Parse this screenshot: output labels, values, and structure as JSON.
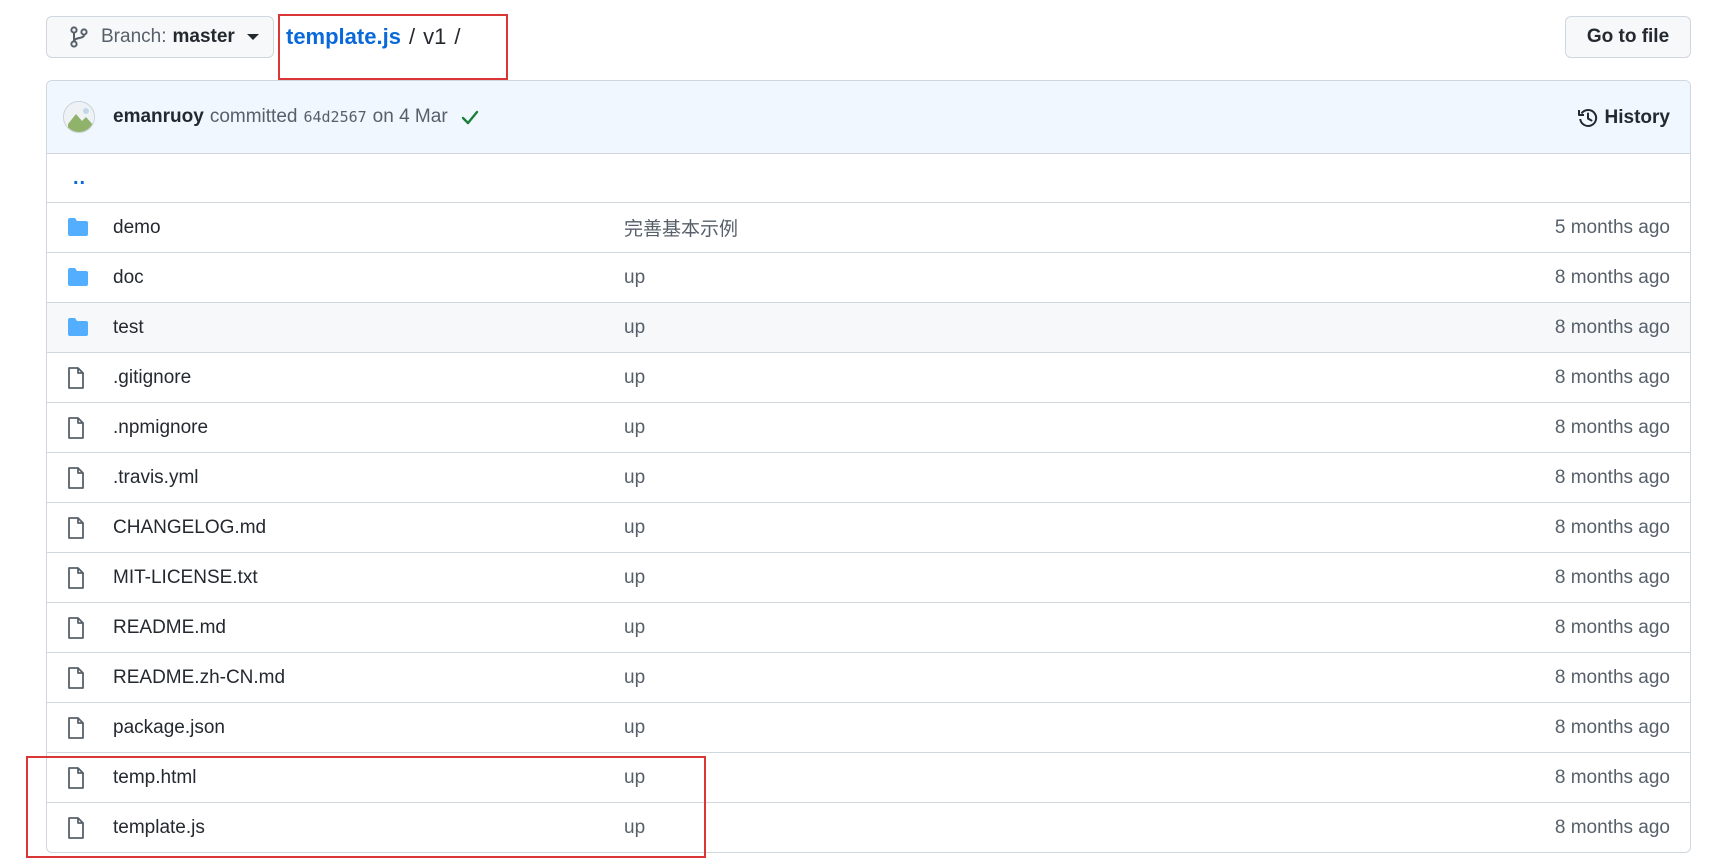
{
  "branch": {
    "label": "Branch:",
    "value": "master"
  },
  "breadcrumb": {
    "repo": "template.js",
    "sep1": "/",
    "segment": "v1",
    "sep2": "/"
  },
  "goto_file": "Go to file",
  "commit": {
    "author": "emanruoy",
    "verb": "committed",
    "sha": "64d2567",
    "date": "on 4 Mar",
    "history": "History"
  },
  "parent_link": "..",
  "files": [
    {
      "name": "demo",
      "type": "folder",
      "message": "完善基本示例",
      "age": "5 months ago"
    },
    {
      "name": "doc",
      "type": "folder",
      "message": "up",
      "age": "8 months ago"
    },
    {
      "name": "test",
      "type": "folder",
      "message": "up",
      "age": "8 months ago"
    },
    {
      "name": ".gitignore",
      "type": "file",
      "message": "up",
      "age": "8 months ago"
    },
    {
      "name": ".npmignore",
      "type": "file",
      "message": "up",
      "age": "8 months ago"
    },
    {
      "name": ".travis.yml",
      "type": "file",
      "message": "up",
      "age": "8 months ago"
    },
    {
      "name": "CHANGELOG.md",
      "type": "file",
      "message": "up",
      "age": "8 months ago"
    },
    {
      "name": "MIT-LICENSE.txt",
      "type": "file",
      "message": "up",
      "age": "8 months ago"
    },
    {
      "name": "README.md",
      "type": "file",
      "message": "up",
      "age": "8 months ago"
    },
    {
      "name": "README.zh-CN.md",
      "type": "file",
      "message": "up",
      "age": "8 months ago"
    },
    {
      "name": "package.json",
      "type": "file",
      "message": "up",
      "age": "8 months ago"
    },
    {
      "name": "temp.html",
      "type": "file",
      "message": "up",
      "age": "8 months ago"
    },
    {
      "name": "template.js",
      "type": "file",
      "message": "up",
      "age": "8 months ago"
    }
  ],
  "colors": {
    "link": "#0969da",
    "folder": "#54aeff",
    "check": "#1a7f37",
    "annotation": "#d93636"
  }
}
